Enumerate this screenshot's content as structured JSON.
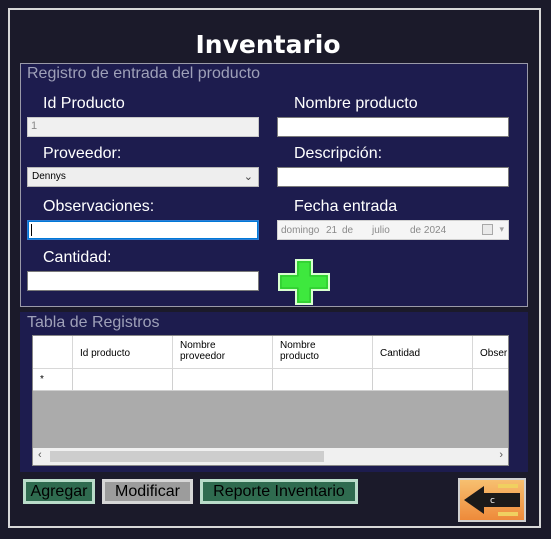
{
  "window": {
    "title": "Inventario"
  },
  "entry_group": {
    "title": "Registro de entrada del producto",
    "id_label": "Id Producto",
    "id_value": "1",
    "nombre_label": "Nombre producto",
    "nombre_value": "",
    "proveedor_label": "Proveedor:",
    "proveedor_value": "Dennys",
    "descripcion_label": "Descripción:",
    "descripcion_value": "",
    "observaciones_label": "Observaciones:",
    "observaciones_value": "",
    "fecha_label": "Fecha entrada",
    "fecha": {
      "weekday": "domingo",
      "day": "21",
      "de1": "de",
      "month": "julio",
      "year": "de 2024"
    },
    "cantidad_label": "Cantidad:",
    "cantidad_value": "",
    "add_icon": "plus-icon",
    "add_icon_color": "#39e63a"
  },
  "table_group": {
    "title": "Tabla de Registros",
    "columns": [
      "Id producto",
      "Nombre\nproveedor",
      "Nombre\nproducto",
      "Cantidad",
      "Obser"
    ],
    "new_row_marker": "*",
    "rows": []
  },
  "actions": {
    "agregar": "Agregar",
    "modificar": "Modificar",
    "reporte": "Reporte Inventario",
    "back_icon": "back-arrow-icon",
    "back_caption": "c"
  }
}
